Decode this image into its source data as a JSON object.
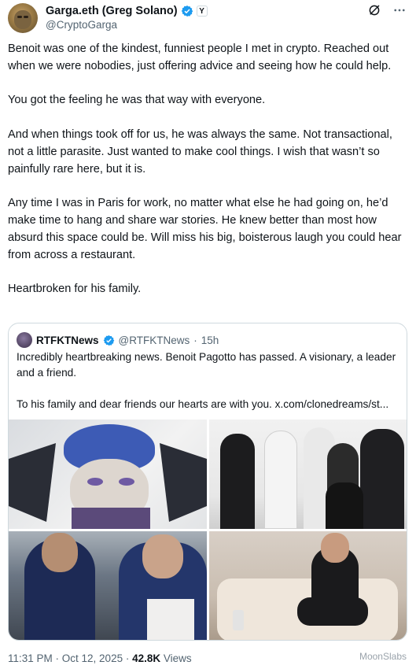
{
  "author": {
    "display_name": "Garga.eth (Greg Solano)",
    "handle": "@CryptoGarga",
    "affiliate_badge": "Y"
  },
  "header_icons": [
    "grok-icon",
    "more-icon"
  ],
  "tweet": {
    "paragraphs": [
      "Benoit was one of the kindest, funniest people I met in crypto. Reached out when we were nobodies, just offering advice and seeing how he could help.",
      "You got the feeling he was that way with everyone.",
      "And when things took off for us, he was always the same. Not transactional, not a little parasite. Just wanted to make cool things. I wish that wasn’t so painfully rare here, but it is.",
      "Any time I was in Paris for work, no matter what else he had going on, he’d make time to hang and share war stories. He knew better than most how absurd this space could be. Will miss his big, boisterous laugh you could hear from across a restaurant.",
      "Heartbroken for his family."
    ]
  },
  "quote": {
    "name": "RTFKTNews",
    "handle": "@RTFKTNews",
    "time": "15h",
    "paragraphs": [
      "Incredibly heartbreaking news. Benoit Pagotto has passed. A visionary, a leader and a friend.",
      "To his family and dear friends our hearts are with you.  x.com/clonedreams/st..."
    ]
  },
  "footer": {
    "time": "11:31 PM · Oct 12, 2025 ·",
    "views": "42.8K",
    "views_label": "Views"
  },
  "watermark": "MoonSlabs",
  "colors": {
    "verified": "#1d9bf0",
    "muted": "#536471",
    "border": "#cfd9de"
  }
}
